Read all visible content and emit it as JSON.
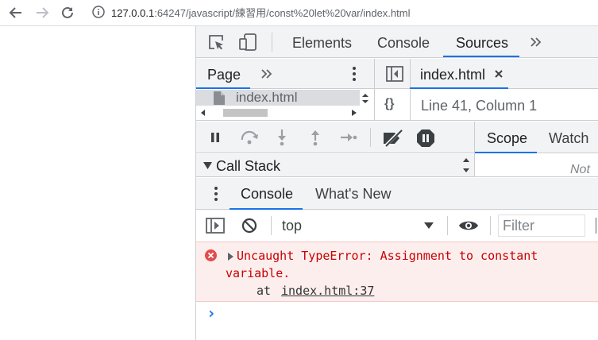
{
  "browser": {
    "url_host": "127.0.0.1",
    "url_rest": ":64247/javascript/練習用/const%20let%20var/index.html"
  },
  "devtools": {
    "main_tabs": [
      "Elements",
      "Console",
      "Sources"
    ],
    "active_main_tab": "Sources",
    "navigator": {
      "tab_label": "Page",
      "file": "index.html"
    },
    "editor": {
      "open_file": "index.html",
      "status": "Line 41, Column 1",
      "format_label": "{}"
    },
    "debugger": {
      "scope_tab": "Scope",
      "watch_tab": "Watch",
      "call_stack_label": "Call Stack",
      "scope_placeholder": "Not"
    },
    "drawer": {
      "tabs": [
        "Console",
        "What's New"
      ],
      "active_tab": "Console"
    },
    "console_toolbar": {
      "context": "top",
      "filter_placeholder": "Filter"
    },
    "console": {
      "error_line1": "Uncaught TypeError: Assignment to constant",
      "error_line2": "variable.",
      "stack_prefix": "at",
      "stack_link": "index.html:37",
      "prompt": "›"
    }
  },
  "colors": {
    "accent": "#1a73e8",
    "error_bg": "#fdeeee",
    "error_text": "#c80000"
  }
}
